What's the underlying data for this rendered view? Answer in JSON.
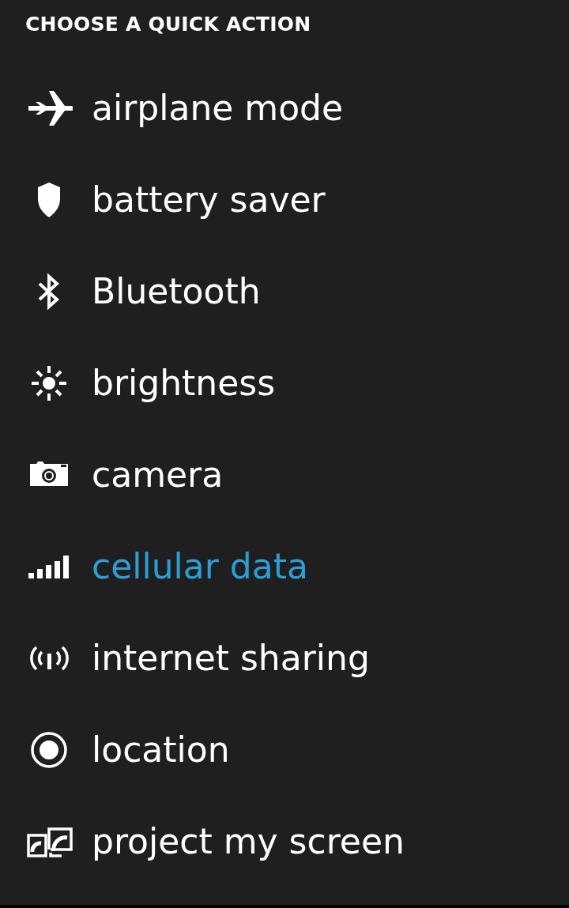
{
  "header": "CHOOSE A QUICK ACTION",
  "actions": [
    {
      "kind": "airplane",
      "label": "airplane mode",
      "selected": false
    },
    {
      "kind": "shield",
      "label": "battery saver",
      "selected": false
    },
    {
      "kind": "bluetooth",
      "label": "Bluetooth",
      "selected": false
    },
    {
      "kind": "brightness",
      "label": "brightness",
      "selected": false
    },
    {
      "kind": "camera",
      "label": "camera",
      "selected": false
    },
    {
      "kind": "signal",
      "label": "cellular data",
      "selected": true
    },
    {
      "kind": "sharing",
      "label": "internet sharing",
      "selected": false
    },
    {
      "kind": "location",
      "label": "location",
      "selected": false
    },
    {
      "kind": "project",
      "label": "project my screen",
      "selected": false
    }
  ]
}
